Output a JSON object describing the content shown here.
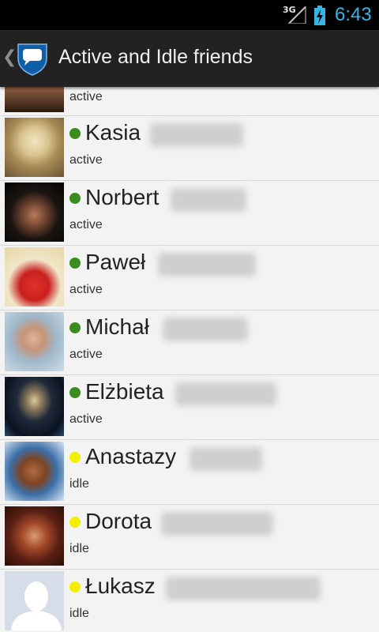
{
  "status_bar": {
    "network": "3G",
    "time": "6:43",
    "clock_color": "#33b5e5"
  },
  "action_bar": {
    "title": "Active and Idle friends",
    "back_icon": "chevron-left-icon",
    "logo_icon": "chat-shield-logo"
  },
  "colors": {
    "active": "#3c8b1e",
    "idle": "#f2ef00",
    "actionbar": "#222222"
  },
  "list": {
    "partial_row": {
      "status": "active"
    },
    "items": [
      {
        "first_name": "Kasia",
        "status": "active"
      },
      {
        "first_name": "Norbert",
        "status": "active"
      },
      {
        "first_name": "Paweł",
        "status": "active"
      },
      {
        "first_name": "Michał",
        "status": "active"
      },
      {
        "first_name": "Elżbieta",
        "status": "active"
      },
      {
        "first_name": "Anastazy",
        "status": "idle"
      },
      {
        "first_name": "Dorota",
        "status": "idle"
      },
      {
        "first_name": "Łukasz",
        "status": "idle"
      }
    ]
  }
}
